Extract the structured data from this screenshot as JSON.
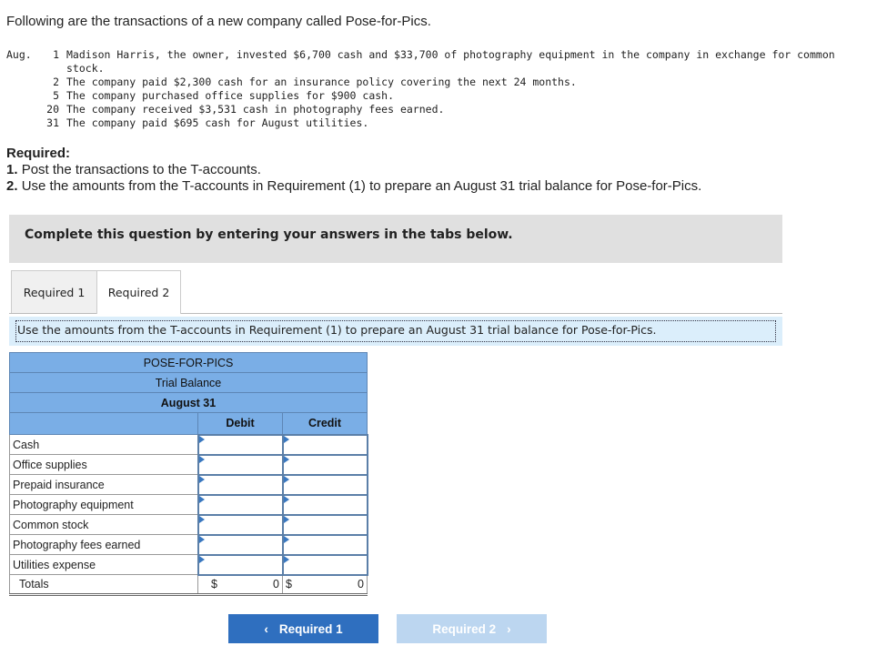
{
  "intro": "Following are the transactions of a new company called Pose-for-Pics.",
  "transactions": {
    "month": "Aug.",
    "items": [
      {
        "day": "1",
        "text": "Madison Harris, the owner, invested $6,700 cash and $33,700 of photography equipment in the company in exchange for common stock."
      },
      {
        "day": "2",
        "text": "The company paid $2,300 cash for an insurance policy covering the next 24 months."
      },
      {
        "day": "5",
        "text": "The company purchased office supplies for $900 cash."
      },
      {
        "day": "20",
        "text": "The company received $3,531 cash in photography fees earned."
      },
      {
        "day": "31",
        "text": "The company paid $695 cash for August utilities."
      }
    ]
  },
  "required": {
    "heading": "Required:",
    "items": [
      {
        "num": "1.",
        "text": "Post the transactions to the T-accounts."
      },
      {
        "num": "2.",
        "text": "Use the amounts from the T-accounts in Requirement (1) to prepare an August 31 trial balance for Pose-for-Pics."
      }
    ]
  },
  "banner": "Complete this question by entering your answers in the tabs below.",
  "tabs": [
    {
      "label": "Required 1"
    },
    {
      "label": "Required 2",
      "active": true
    }
  ],
  "instruction": "Use the amounts from the T-accounts in Requirement (1) to prepare an August 31 trial balance for Pose-for-Pics.",
  "table": {
    "company": "POSE-FOR-PICS",
    "title": "Trial Balance",
    "date": "August 31",
    "debit": "Debit",
    "credit": "Credit",
    "rows": [
      {
        "label": "Cash"
      },
      {
        "label": "Office supplies"
      },
      {
        "label": "Prepaid insurance"
      },
      {
        "label": "Photography equipment"
      },
      {
        "label": "Common stock"
      },
      {
        "label": "Photography fees earned"
      },
      {
        "label": "Utilities expense"
      }
    ],
    "totals": {
      "label": "Totals",
      "currency": "$",
      "debit": "0",
      "credit": "0"
    }
  },
  "nav": {
    "prev": "Required 1",
    "next": "Required 2"
  },
  "colors": {
    "header": "#7aaee6",
    "prev_button": "#2f6fbf",
    "next_button": "#bcd6f0"
  }
}
